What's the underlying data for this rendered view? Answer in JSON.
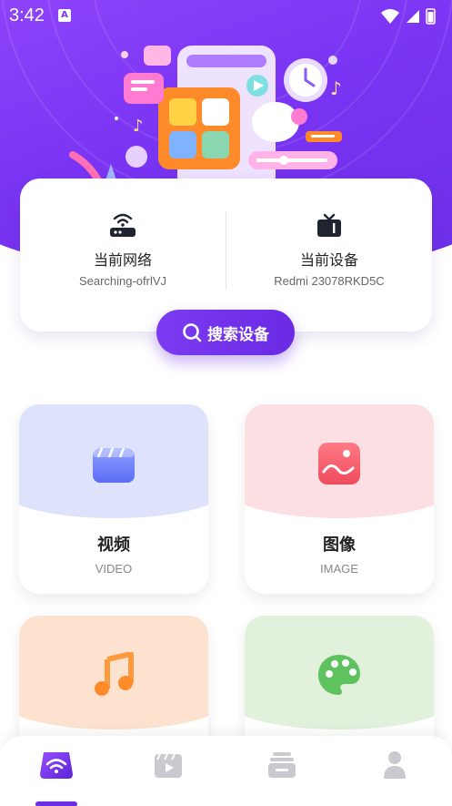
{
  "status_bar": {
    "time": "3:42",
    "notification_letter": "A"
  },
  "network_card": {
    "network": {
      "title": "当前网络",
      "value": "Searching-ofrlVJ",
      "icon": "router-icon"
    },
    "device": {
      "title": "当前设备",
      "value": "Redmi 23078RKD5C",
      "icon": "tv-icon"
    }
  },
  "search_button": {
    "label": "搜索设备",
    "icon": "search-icon"
  },
  "categories": [
    {
      "name": "视频",
      "en": "VIDEO",
      "icon": "video-clapper-icon",
      "tint": "#dfe2fb"
    },
    {
      "name": "图像",
      "en": "IMAGE",
      "icon": "image-icon",
      "tint": "#fbdfe3"
    },
    {
      "name": "",
      "en": "",
      "icon": "music-note-icon",
      "tint": "#fde3cf"
    },
    {
      "name": "",
      "en": "",
      "icon": "palette-icon",
      "tint": "#e1f1dc"
    }
  ],
  "bottom_nav": [
    {
      "id": "cast",
      "icon": "wifi-cast-icon",
      "active": true
    },
    {
      "id": "media",
      "icon": "clapper-play-icon",
      "active": false
    },
    {
      "id": "files",
      "icon": "layers-icon",
      "active": false
    },
    {
      "id": "profile",
      "icon": "user-icon",
      "active": false
    }
  ],
  "colors": {
    "primary": "#6b2ee6",
    "hero_light": "#9a4dff"
  }
}
